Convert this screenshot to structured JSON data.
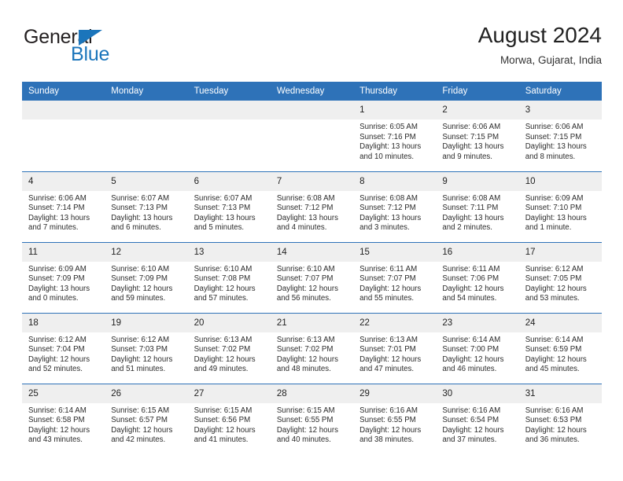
{
  "brand": {
    "line1": "General",
    "line2": "Blue",
    "triangle_icon": "triangle-icon",
    "color_dark": "#231f20",
    "color_blue": "#1b75bb"
  },
  "header": {
    "title": "August 2024",
    "subtitle": "Morwa, Gujarat, India"
  },
  "theme": {
    "header_blue": "#2e72b8",
    "daynum_band": "#efefef",
    "text": "#222222"
  },
  "weekday_headers": [
    "Sunday",
    "Monday",
    "Tuesday",
    "Wednesday",
    "Thursday",
    "Friday",
    "Saturday"
  ],
  "weeks": [
    [
      {
        "day": "",
        "sunrise": "",
        "sunset": "",
        "daylight1": "",
        "daylight2": ""
      },
      {
        "day": "",
        "sunrise": "",
        "sunset": "",
        "daylight1": "",
        "daylight2": ""
      },
      {
        "day": "",
        "sunrise": "",
        "sunset": "",
        "daylight1": "",
        "daylight2": ""
      },
      {
        "day": "",
        "sunrise": "",
        "sunset": "",
        "daylight1": "",
        "daylight2": ""
      },
      {
        "day": "1",
        "sunrise": "Sunrise: 6:05 AM",
        "sunset": "Sunset: 7:16 PM",
        "daylight1": "Daylight: 13 hours",
        "daylight2": "and 10 minutes."
      },
      {
        "day": "2",
        "sunrise": "Sunrise: 6:06 AM",
        "sunset": "Sunset: 7:15 PM",
        "daylight1": "Daylight: 13 hours",
        "daylight2": "and 9 minutes."
      },
      {
        "day": "3",
        "sunrise": "Sunrise: 6:06 AM",
        "sunset": "Sunset: 7:15 PM",
        "daylight1": "Daylight: 13 hours",
        "daylight2": "and 8 minutes."
      }
    ],
    [
      {
        "day": "4",
        "sunrise": "Sunrise: 6:06 AM",
        "sunset": "Sunset: 7:14 PM",
        "daylight1": "Daylight: 13 hours",
        "daylight2": "and 7 minutes."
      },
      {
        "day": "5",
        "sunrise": "Sunrise: 6:07 AM",
        "sunset": "Sunset: 7:13 PM",
        "daylight1": "Daylight: 13 hours",
        "daylight2": "and 6 minutes."
      },
      {
        "day": "6",
        "sunrise": "Sunrise: 6:07 AM",
        "sunset": "Sunset: 7:13 PM",
        "daylight1": "Daylight: 13 hours",
        "daylight2": "and 5 minutes."
      },
      {
        "day": "7",
        "sunrise": "Sunrise: 6:08 AM",
        "sunset": "Sunset: 7:12 PM",
        "daylight1": "Daylight: 13 hours",
        "daylight2": "and 4 minutes."
      },
      {
        "day": "8",
        "sunrise": "Sunrise: 6:08 AM",
        "sunset": "Sunset: 7:12 PM",
        "daylight1": "Daylight: 13 hours",
        "daylight2": "and 3 minutes."
      },
      {
        "day": "9",
        "sunrise": "Sunrise: 6:08 AM",
        "sunset": "Sunset: 7:11 PM",
        "daylight1": "Daylight: 13 hours",
        "daylight2": "and 2 minutes."
      },
      {
        "day": "10",
        "sunrise": "Sunrise: 6:09 AM",
        "sunset": "Sunset: 7:10 PM",
        "daylight1": "Daylight: 13 hours",
        "daylight2": "and 1 minute."
      }
    ],
    [
      {
        "day": "11",
        "sunrise": "Sunrise: 6:09 AM",
        "sunset": "Sunset: 7:09 PM",
        "daylight1": "Daylight: 13 hours",
        "daylight2": "and 0 minutes."
      },
      {
        "day": "12",
        "sunrise": "Sunrise: 6:10 AM",
        "sunset": "Sunset: 7:09 PM",
        "daylight1": "Daylight: 12 hours",
        "daylight2": "and 59 minutes."
      },
      {
        "day": "13",
        "sunrise": "Sunrise: 6:10 AM",
        "sunset": "Sunset: 7:08 PM",
        "daylight1": "Daylight: 12 hours",
        "daylight2": "and 57 minutes."
      },
      {
        "day": "14",
        "sunrise": "Sunrise: 6:10 AM",
        "sunset": "Sunset: 7:07 PM",
        "daylight1": "Daylight: 12 hours",
        "daylight2": "and 56 minutes."
      },
      {
        "day": "15",
        "sunrise": "Sunrise: 6:11 AM",
        "sunset": "Sunset: 7:07 PM",
        "daylight1": "Daylight: 12 hours",
        "daylight2": "and 55 minutes."
      },
      {
        "day": "16",
        "sunrise": "Sunrise: 6:11 AM",
        "sunset": "Sunset: 7:06 PM",
        "daylight1": "Daylight: 12 hours",
        "daylight2": "and 54 minutes."
      },
      {
        "day": "17",
        "sunrise": "Sunrise: 6:12 AM",
        "sunset": "Sunset: 7:05 PM",
        "daylight1": "Daylight: 12 hours",
        "daylight2": "and 53 minutes."
      }
    ],
    [
      {
        "day": "18",
        "sunrise": "Sunrise: 6:12 AM",
        "sunset": "Sunset: 7:04 PM",
        "daylight1": "Daylight: 12 hours",
        "daylight2": "and 52 minutes."
      },
      {
        "day": "19",
        "sunrise": "Sunrise: 6:12 AM",
        "sunset": "Sunset: 7:03 PM",
        "daylight1": "Daylight: 12 hours",
        "daylight2": "and 51 minutes."
      },
      {
        "day": "20",
        "sunrise": "Sunrise: 6:13 AM",
        "sunset": "Sunset: 7:02 PM",
        "daylight1": "Daylight: 12 hours",
        "daylight2": "and 49 minutes."
      },
      {
        "day": "21",
        "sunrise": "Sunrise: 6:13 AM",
        "sunset": "Sunset: 7:02 PM",
        "daylight1": "Daylight: 12 hours",
        "daylight2": "and 48 minutes."
      },
      {
        "day": "22",
        "sunrise": "Sunrise: 6:13 AM",
        "sunset": "Sunset: 7:01 PM",
        "daylight1": "Daylight: 12 hours",
        "daylight2": "and 47 minutes."
      },
      {
        "day": "23",
        "sunrise": "Sunrise: 6:14 AM",
        "sunset": "Sunset: 7:00 PM",
        "daylight1": "Daylight: 12 hours",
        "daylight2": "and 46 minutes."
      },
      {
        "day": "24",
        "sunrise": "Sunrise: 6:14 AM",
        "sunset": "Sunset: 6:59 PM",
        "daylight1": "Daylight: 12 hours",
        "daylight2": "and 45 minutes."
      }
    ],
    [
      {
        "day": "25",
        "sunrise": "Sunrise: 6:14 AM",
        "sunset": "Sunset: 6:58 PM",
        "daylight1": "Daylight: 12 hours",
        "daylight2": "and 43 minutes."
      },
      {
        "day": "26",
        "sunrise": "Sunrise: 6:15 AM",
        "sunset": "Sunset: 6:57 PM",
        "daylight1": "Daylight: 12 hours",
        "daylight2": "and 42 minutes."
      },
      {
        "day": "27",
        "sunrise": "Sunrise: 6:15 AM",
        "sunset": "Sunset: 6:56 PM",
        "daylight1": "Daylight: 12 hours",
        "daylight2": "and 41 minutes."
      },
      {
        "day": "28",
        "sunrise": "Sunrise: 6:15 AM",
        "sunset": "Sunset: 6:55 PM",
        "daylight1": "Daylight: 12 hours",
        "daylight2": "and 40 minutes."
      },
      {
        "day": "29",
        "sunrise": "Sunrise: 6:16 AM",
        "sunset": "Sunset: 6:55 PM",
        "daylight1": "Daylight: 12 hours",
        "daylight2": "and 38 minutes."
      },
      {
        "day": "30",
        "sunrise": "Sunrise: 6:16 AM",
        "sunset": "Sunset: 6:54 PM",
        "daylight1": "Daylight: 12 hours",
        "daylight2": "and 37 minutes."
      },
      {
        "day": "31",
        "sunrise": "Sunrise: 6:16 AM",
        "sunset": "Sunset: 6:53 PM",
        "daylight1": "Daylight: 12 hours",
        "daylight2": "and 36 minutes."
      }
    ]
  ]
}
